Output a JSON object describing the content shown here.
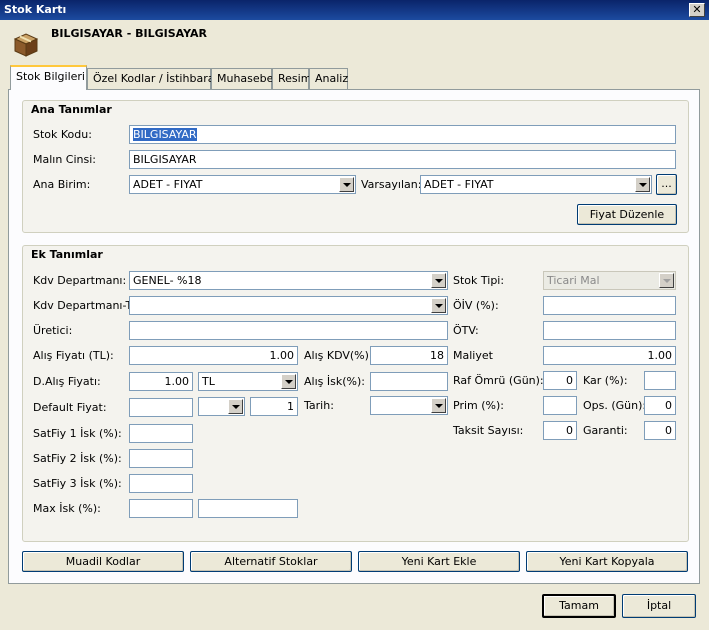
{
  "window": {
    "title": "Stok Kartı",
    "close": "✕"
  },
  "header": {
    "title": "BILGISAYAR - BILGISAYAR"
  },
  "tabs": [
    "Stok Bilgileri",
    "Özel Kodlar / İstihbarat",
    "Muhasebe",
    "Resim",
    "Analiz"
  ],
  "ana": {
    "title": "Ana Tanımlar",
    "stok_kodu_label": "Stok Kodu:",
    "stok_kodu": "BILGISAYAR",
    "malin_cinsi_label": "Malın Cinsi:",
    "malin_cinsi": "BILGISAYAR",
    "ana_birim_label": "Ana Birim:",
    "ana_birim": "ADET - FIYAT",
    "varsayilan_label": "Varsayılan:",
    "varsayilan": "ADET - FIYAT",
    "browse": "...",
    "fiyat_duzenle": "Fiyat Düzenle"
  },
  "ek": {
    "title": "Ek Tanımlar",
    "kdv_dep_label": "Kdv Departmanı:",
    "kdv_dep": "GENEL- %18",
    "kdv_dep_t_label": "Kdv Departmanı-T:",
    "kdv_dep_t": "",
    "uretici_label": "Üretici:",
    "uretici": "",
    "alis_fiyati_label": "Alış Fiyatı (TL):",
    "alis_fiyati": "1.00",
    "alis_kdv_label": "Alış KDV(%):",
    "alis_kdv": "18",
    "d_alis_label": "D.Alış Fiyatı:",
    "d_alis": "1.00",
    "doviz": "TL",
    "alis_isk_label": "Alış İsk(%):",
    "alis_isk": "",
    "default_fiyat_label": "Default Fiyat:",
    "default_fiyat": "",
    "default_combo": "",
    "default_num": "1",
    "tarih_label": "Tarih:",
    "tarih": "",
    "satfiy1_label": "SatFiy 1 İsk (%):",
    "satfiy2_label": "SatFiy 2 İsk (%):",
    "satfiy3_label": "SatFiy 3 İsk (%):",
    "max_isk_label": "Max İsk (%):",
    "stok_tipi_label": "Stok Tipi:",
    "stok_tipi": "Ticari Mal",
    "oiv_label": "ÖİV (%):",
    "oiv": "",
    "otv_label": "ÖTV:",
    "otv": "",
    "maliyet_label": "Maliyet",
    "maliyet": "1.00",
    "raf_omru_label": "Raf Ömrü (Gün):",
    "raf_omru": "0",
    "kar_label": "Kar (%):",
    "kar": "",
    "prim_label": "Prim (%):",
    "prim": "",
    "ops_label": "Ops. (Gün):",
    "ops": "0",
    "taksit_label": "Taksit Sayısı:",
    "taksit": "0",
    "garanti_label": "Garanti:",
    "garanti": "0"
  },
  "bottom_buttons": [
    "Muadil Kodlar",
    "Alternatif Stoklar",
    "Yeni Kart Ekle",
    "Yeni Kart Kopyala"
  ],
  "footer": {
    "ok": "Tamam",
    "cancel": "İptal"
  },
  "colors": {
    "titlebar": "#0a246a",
    "face": "#ece9d8",
    "selection": "#316ac5"
  }
}
